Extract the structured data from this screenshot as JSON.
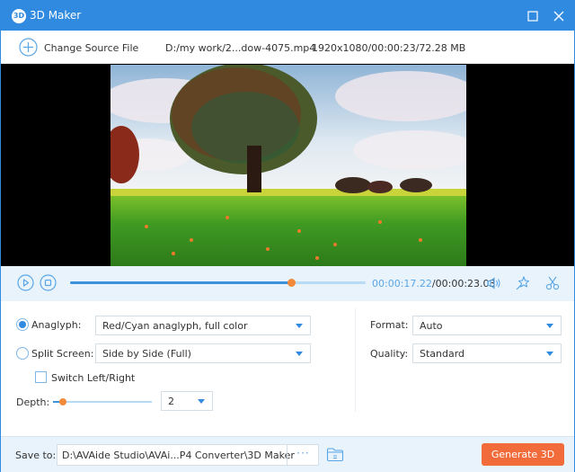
{
  "window": {
    "title": "3D Maker",
    "logo_text": "3D"
  },
  "source": {
    "change_label": "Change Source File",
    "file_path": "D:/my work/2...dow-4075.mp4",
    "file_info": "1920x1080/00:00:23/72.28 MB"
  },
  "player": {
    "current_time": "00:00:17.22",
    "total_time": "/00:00:23.03",
    "progress_fraction": 0.748
  },
  "settings": {
    "anaglyph": {
      "label": "Anaglyph:",
      "selected": true,
      "value": "Red/Cyan anaglyph, full color"
    },
    "split_screen": {
      "label": "Split Screen:",
      "selected": false,
      "value": "Side by Side (Full)"
    },
    "switch_lr": {
      "label": "Switch Left/Right",
      "checked": false
    },
    "depth": {
      "label": "Depth:",
      "value": "2",
      "slider_fraction": 0.1
    },
    "format": {
      "label": "Format:",
      "value": "Auto"
    },
    "quality": {
      "label": "Quality:",
      "value": "Standard"
    }
  },
  "footer": {
    "save_label": "Save to:",
    "save_path": "D:\\AVAide Studio\\AVAi...P4 Converter\\3D Maker",
    "browse_label": "···",
    "generate_label": "Generate 3D"
  },
  "colors": {
    "accent": "#2f8ae0",
    "cta": "#f26b3a",
    "slider_thumb": "#f28a3c",
    "control_bg": "#e8f3fc"
  }
}
